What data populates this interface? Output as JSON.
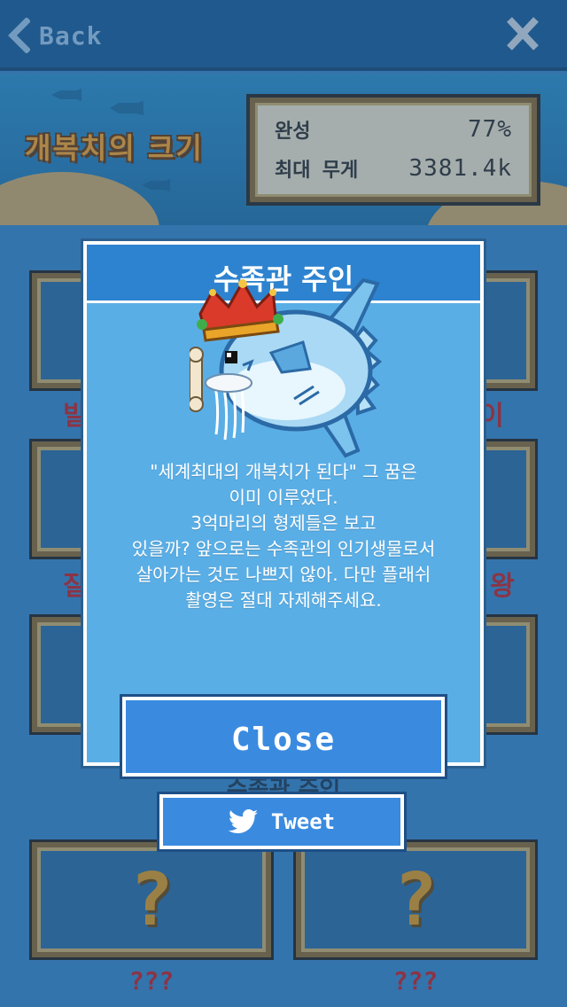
{
  "nav": {
    "back_label": "Back"
  },
  "banner": {
    "title": "개복치의 크기",
    "stats": [
      {
        "label": "완성",
        "value": "77%"
      },
      {
        "label": "최대 무게",
        "value": "3381.4k"
      }
    ]
  },
  "grid": {
    "partial_labels": {
      "row1_left": "발",
      "row1_right": "이",
      "row2_left": "잘",
      "row2_right": "왕"
    },
    "locked_cards": [
      {
        "symbol": "?",
        "label": "???"
      },
      {
        "symbol": "?",
        "label": "???"
      }
    ],
    "peek_label": "수족관 주인"
  },
  "modal": {
    "title": "수족관 주인",
    "description": "\"세계최대의 개복치가 된다\" 그 꿈은\n이미 이루었다.\n3억마리의 형제들은 보고\n있을까? 앞으로는 수족관의 인기생물로서\n살아가는 것도 나쁘지 않아. 다만 플래쉬\n촬영은 절대 자제해주세요.",
    "close_label": "Close"
  },
  "share": {
    "tweet_label": "Tweet",
    "icon": "twitter-bird-icon"
  },
  "colors": {
    "background": "#3b87c8",
    "topbar": "#1d5e98",
    "modal_bg": "#5aaee6",
    "modal_header": "#2d83cf",
    "button": "#3a8be0",
    "frame_gold": "#8a6a36",
    "label_red": "#c0262a",
    "title_orange": "#f2a431"
  }
}
